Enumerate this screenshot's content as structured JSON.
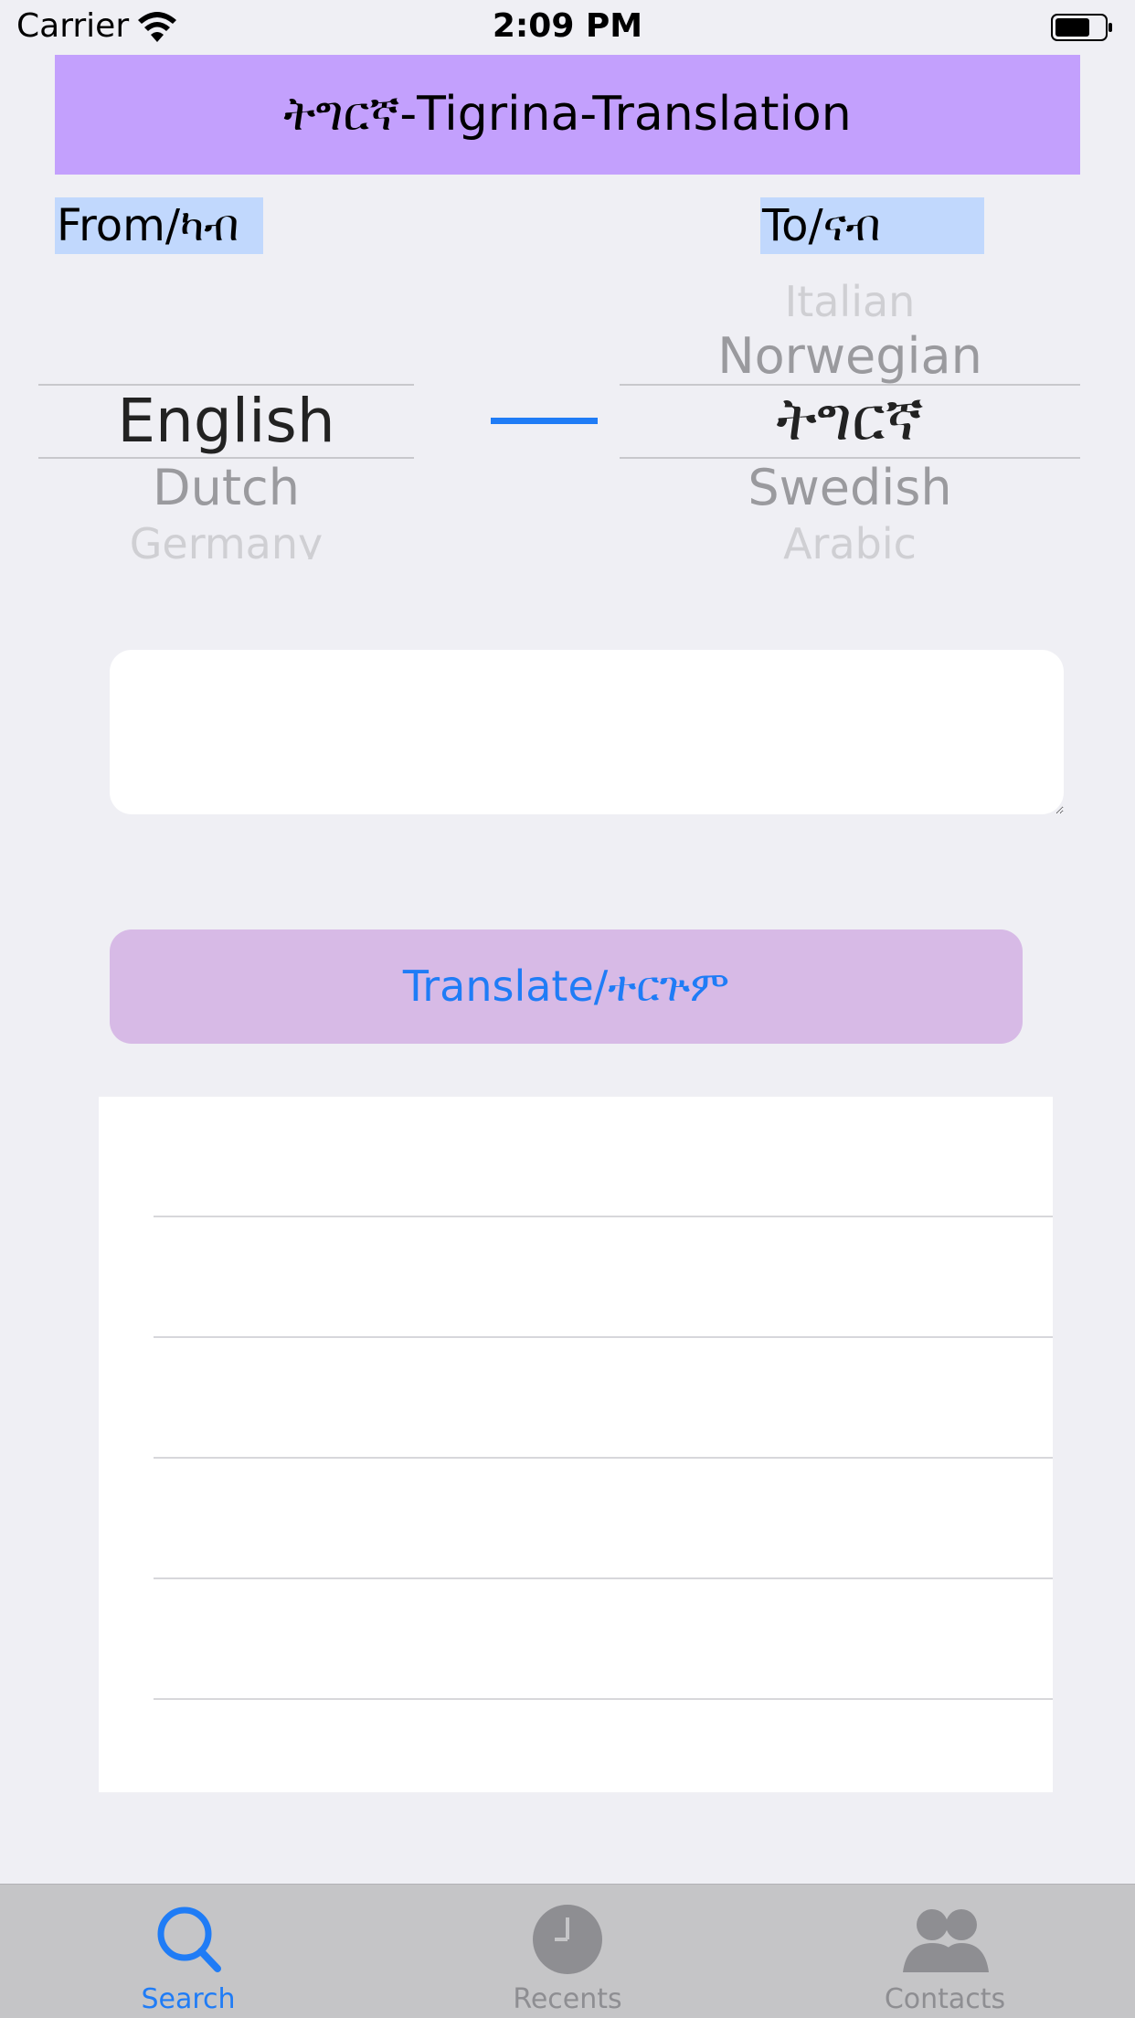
{
  "status_bar": {
    "carrier": "Carrier",
    "time": "2:09 PM"
  },
  "header": {
    "title": "ትግርኛ-Tigrina-Translation"
  },
  "from": {
    "label": "From/ካብ",
    "options_visible": [
      "English",
      "Dutch",
      "Germany"
    ],
    "selected": "English"
  },
  "to": {
    "label": "To/ናብ",
    "options_visible": [
      "Italian",
      "Norwegian",
      "ትግርኛ",
      "Swedish",
      "Arabic"
    ],
    "selected": "ትግርኛ"
  },
  "input": {
    "value": "",
    "placeholder": ""
  },
  "translate_button": {
    "label": "Translate/ተርጕም"
  },
  "results": {
    "rows": [
      "",
      "",
      "",
      "",
      "",
      ""
    ]
  },
  "tabbar": {
    "tabs": [
      {
        "label": "Search",
        "icon": "search-icon",
        "active": true
      },
      {
        "label": "Recents",
        "icon": "clock-icon",
        "active": false
      },
      {
        "label": "Contacts",
        "icon": "contacts-icon",
        "active": false
      }
    ]
  },
  "colors": {
    "accent": "#1f7cf6",
    "header_bg": "#c3a0fd",
    "label_bg": "#c1d8fd",
    "button_bg": "#d7bae6"
  }
}
